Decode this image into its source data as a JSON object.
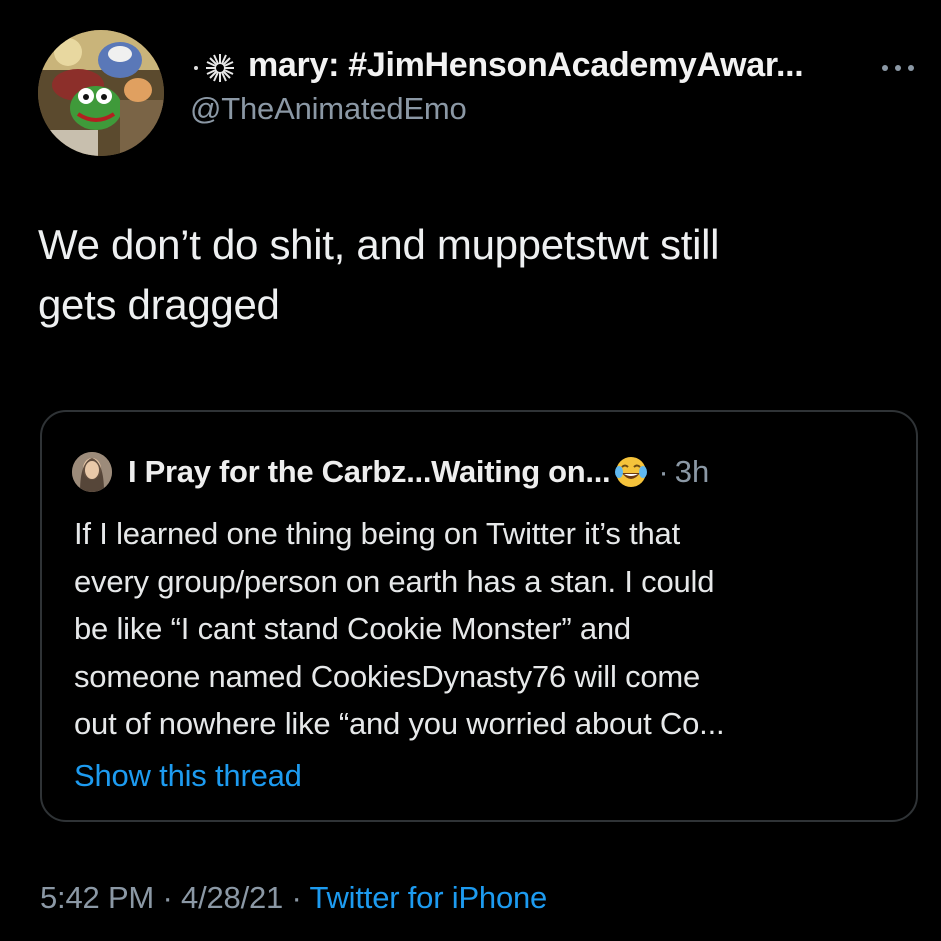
{
  "colors": {
    "background": "#000000",
    "primary_text": "#e7e9ea",
    "secondary_text": "#8b98a5",
    "link": "#1d9bf0",
    "border": "#2f3336"
  },
  "tweet": {
    "author": {
      "display_name": "mary: #JimHensonAcademyAwar...",
      "handle": "@TheAnimatedEmo",
      "avatar_icon": "muppets-avatar",
      "name_prefix_icon": "sparkle-icon"
    },
    "text_line1": "We don’t do shit, and muppetstwt still",
    "text_line2": "gets dragged",
    "more_icon": "more-options-icon"
  },
  "quoted_tweet": {
    "author_name": "I Pray for the Carbz...Waiting on...",
    "emoji": "tears-of-joy-emoji",
    "separator": "·",
    "time": "3h",
    "lines": [
      "If I learned one thing being on Twitter it’s that",
      "every group/person on earth has a stan. I could",
      "be like “I cant stand Cookie Monster” and",
      "someone named CookiesDynasty76 will come",
      "out of nowhere like “and you worried about Co..."
    ],
    "show_thread": "Show this thread"
  },
  "meta": {
    "time": "5:42 PM",
    "dot1": "·",
    "date": "4/28/21",
    "dot2": "·",
    "source": "Twitter for iPhone"
  }
}
